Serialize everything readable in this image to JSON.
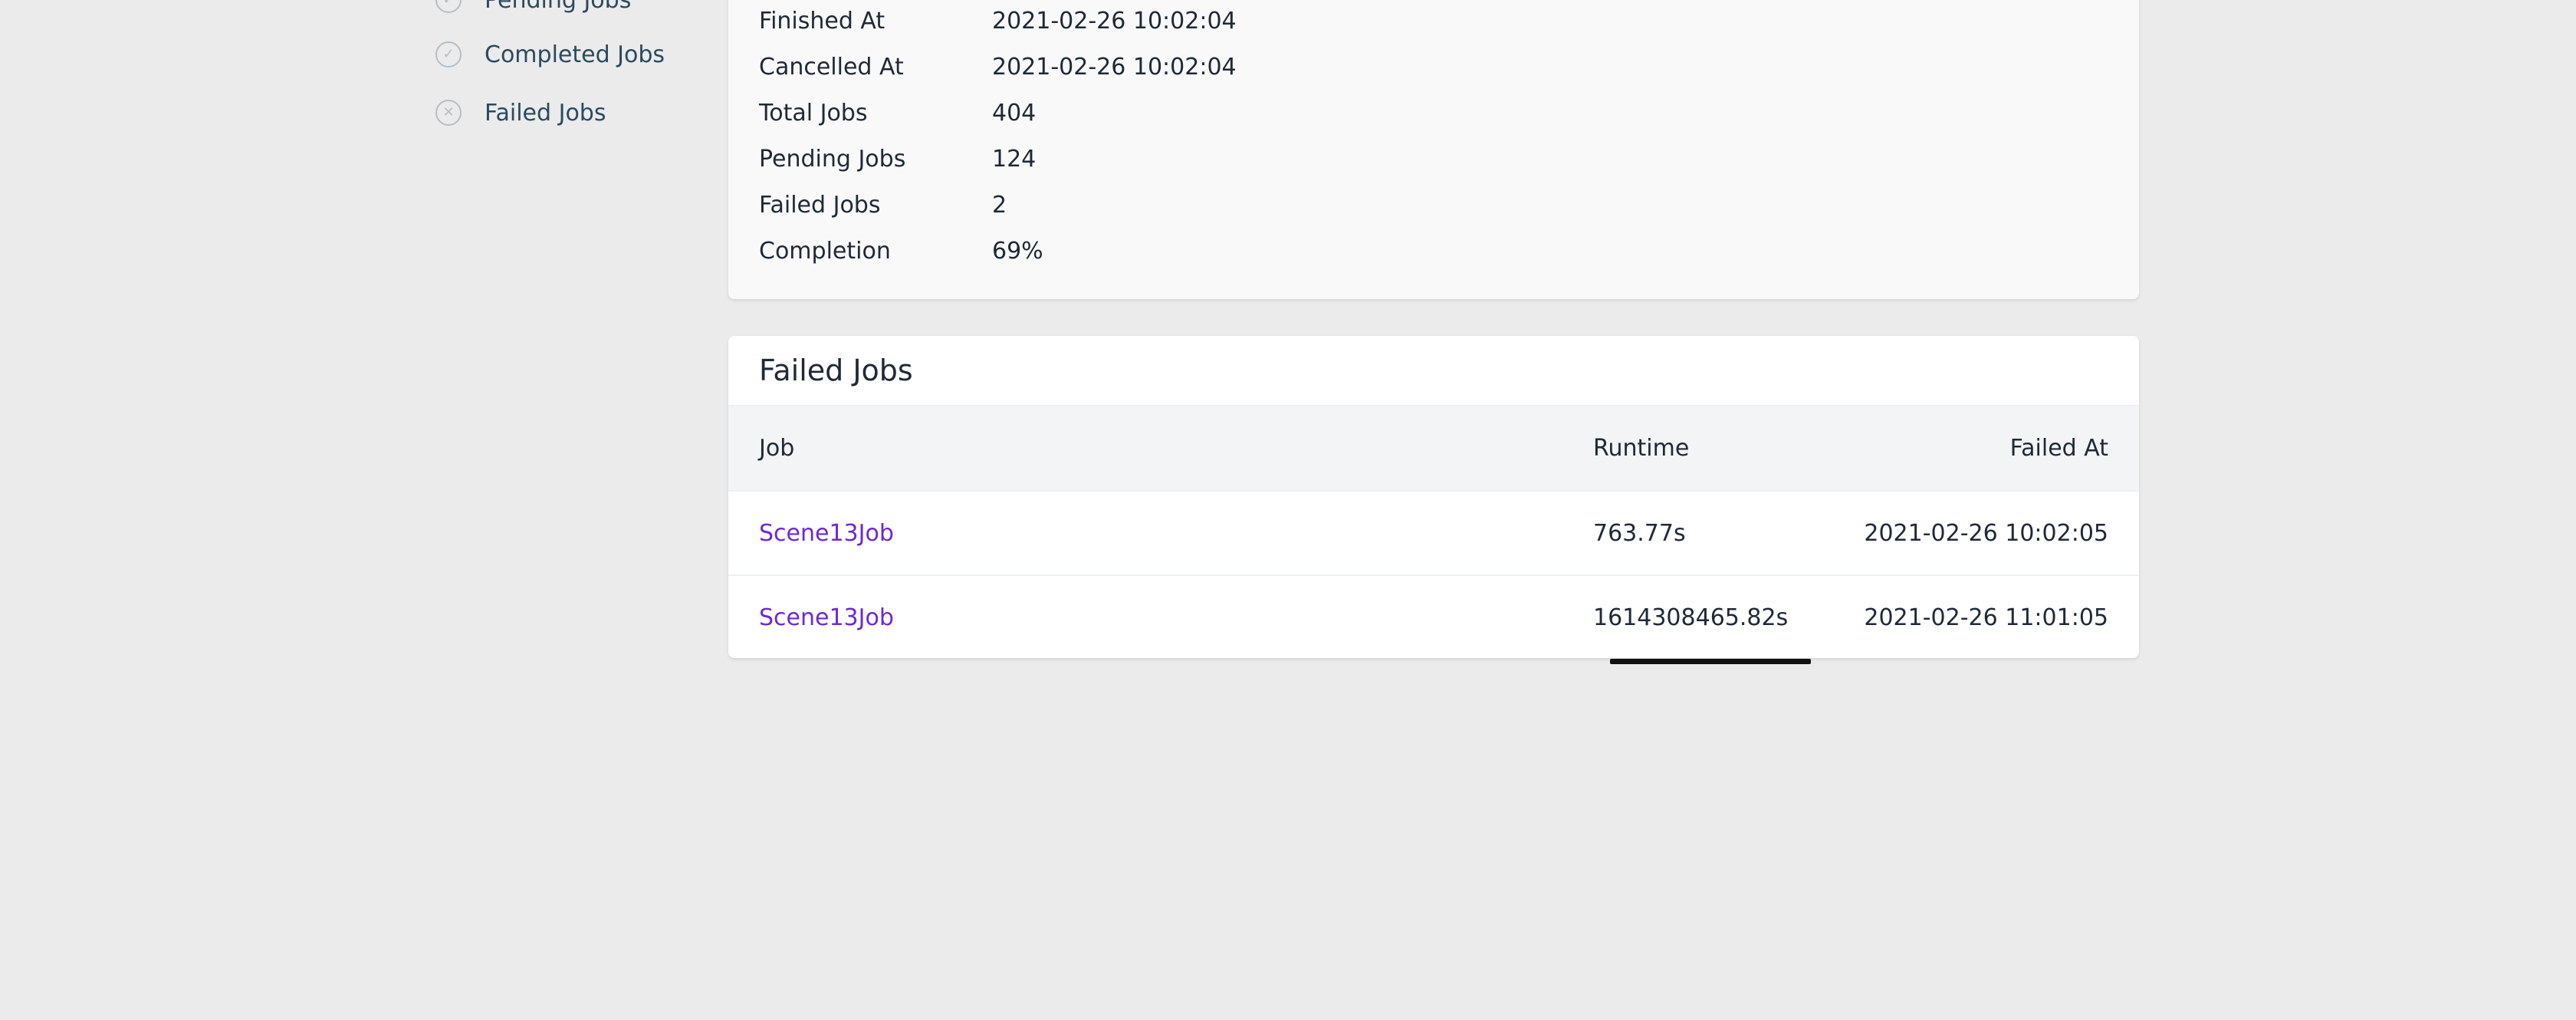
{
  "sidebar": {
    "items": [
      {
        "label": "Pending Jobs",
        "icon": "check-circle-icon"
      },
      {
        "label": "Completed Jobs",
        "icon": "check-circle-icon"
      },
      {
        "label": "Failed Jobs",
        "icon": "x-circle-icon"
      }
    ]
  },
  "batch_info": {
    "rows": [
      {
        "key": "Finished At",
        "value": "2021-02-26 10:02:04"
      },
      {
        "key": "Cancelled At",
        "value": "2021-02-26 10:02:04"
      },
      {
        "key": "Total Jobs",
        "value": "404"
      },
      {
        "key": "Pending Jobs",
        "value": "124"
      },
      {
        "key": "Failed Jobs",
        "value": "2"
      },
      {
        "key": "Completion",
        "value": "69%"
      }
    ]
  },
  "failed_jobs": {
    "title": "Failed Jobs",
    "columns": {
      "job": "Job",
      "runtime": "Runtime",
      "failed_at": "Failed At"
    },
    "rows": [
      {
        "job": "Scene13Job",
        "runtime": "763.77s",
        "failed_at": "2021-02-26 10:02:05"
      },
      {
        "job": "Scene13Job",
        "runtime": "1614308465.82s",
        "failed_at": "2021-02-26 11:01:05"
      }
    ]
  },
  "colors": {
    "link": "#6d28d9",
    "nav_text": "#2a4a5f",
    "background": "#ebebeb"
  }
}
